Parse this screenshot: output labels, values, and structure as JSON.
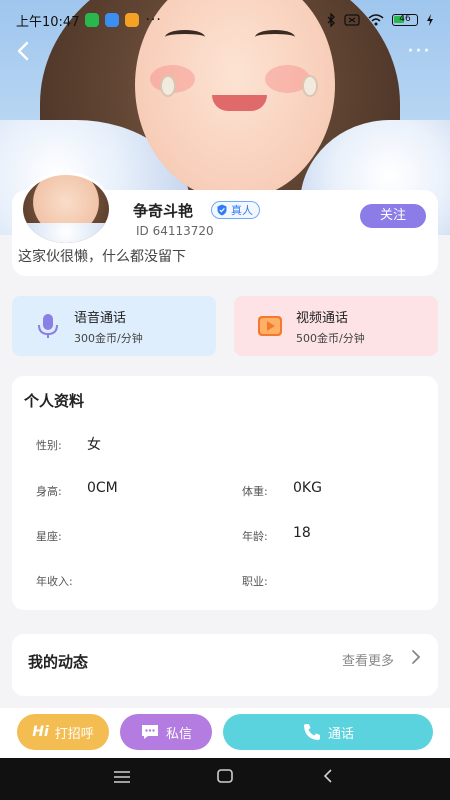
{
  "status_bar": {
    "time": "上午10:47",
    "more_dots": "···",
    "battery_level": "46",
    "icons": [
      "green-app-icon",
      "blue-app-icon",
      "orange-app-icon",
      "bluetooth-icon",
      "sim-icon",
      "wifi-icon",
      "battery-icon",
      "charging-icon"
    ]
  },
  "header": {
    "back_icon": "back-arrow-icon",
    "more_label": "···"
  },
  "profile": {
    "name": "争奇斗艳",
    "verified_label": "真人",
    "id_label": "ID",
    "id_value": "64113720",
    "follow_label": "关注",
    "bio": "这家伙很懒，什么都没留下"
  },
  "calls": {
    "voice": {
      "title": "语音通话",
      "price": "300金币/分钟",
      "icon": "microphone-icon",
      "color": "#8a7fe6"
    },
    "video": {
      "title": "视频通话",
      "price": "500金币/分钟",
      "icon": "video-play-icon",
      "color": "#f37a2c"
    }
  },
  "info": {
    "title": "个人资料",
    "fields": {
      "gender_label": "性别:",
      "gender_value": "女",
      "height_label": "身高:",
      "height_value": "0CM",
      "weight_label": "体重:",
      "weight_value": "0KG",
      "zodiac_label": "星座:",
      "zodiac_value": "",
      "age_label": "年龄:",
      "age_value": "18",
      "income_label": "年收入:",
      "income_value": "",
      "job_label": "职业:",
      "job_value": ""
    }
  },
  "moments": {
    "title": "我的动态",
    "more_label": "查看更多"
  },
  "actions": {
    "greet_hi": "Hi",
    "greet_label": "打招呼",
    "message_label": "私信",
    "call_label": "通话"
  },
  "colors": {
    "follow": "#8b7ce8",
    "greet": "#f4bd51",
    "message": "#b47be0",
    "call": "#5bd3de",
    "voice_bg": "#deeefc",
    "video_bg": "#fde3e6"
  }
}
